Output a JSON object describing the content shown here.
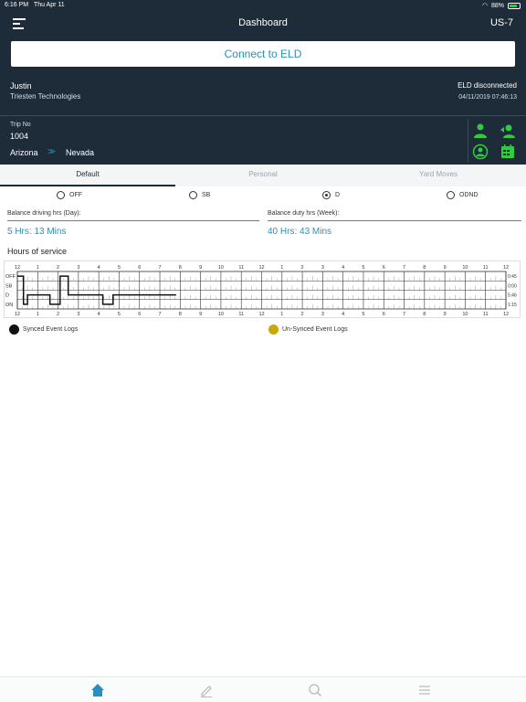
{
  "status_bar": {
    "time": "6:16 PM",
    "date": "Thu Apr 11",
    "battery": "88%"
  },
  "nav": {
    "title": "Dashboard",
    "vehicle": "US-7"
  },
  "connect_label": "Connect to ELD",
  "driver": {
    "name": "Justin",
    "company": "Triesten Technologies"
  },
  "eld": {
    "status": "ELD disconnected",
    "timestamp": "04/11/2019 07:46:13"
  },
  "trip": {
    "label": "Trip No",
    "number": "1004",
    "from": "Arizona",
    "arrows": ">>",
    "to": "Nevada"
  },
  "actions": [
    {
      "icon": "driver-icon"
    },
    {
      "icon": "driver-swap-icon"
    },
    {
      "icon": "driver-sync-icon"
    },
    {
      "icon": "calendar-icon"
    }
  ],
  "tabs": [
    "Default",
    "Personal",
    "Yard Moves"
  ],
  "duty_status": {
    "options": [
      "OFF",
      "SB",
      "D",
      "ODND"
    ],
    "selected": "D"
  },
  "balance": {
    "driving": {
      "label": "Balance driving hrs (Day):",
      "value": "5 Hrs: 13 Mins"
    },
    "duty": {
      "label": "Balance duty hrs (Week):",
      "value": "40 Hrs: 43 Mins"
    }
  },
  "hos": {
    "title": "Hours of service",
    "hour_labels": [
      "12",
      "1",
      "2",
      "3",
      "4",
      "5",
      "6",
      "7",
      "8",
      "9",
      "10",
      "11",
      "12",
      "1",
      "2",
      "3",
      "4",
      "5",
      "6",
      "7",
      "8",
      "9",
      "10",
      "11",
      "12"
    ],
    "rows": [
      "OFF",
      "SB",
      "D",
      "ON"
    ],
    "totals": [
      "0:45",
      "0:00",
      "5:46",
      "1:15"
    ]
  },
  "legend": {
    "synced": {
      "label": "Synced Event Logs",
      "color": "#111111"
    },
    "unsynced": {
      "label": "Un-Synced Event Logs",
      "color": "#c9a80c"
    }
  },
  "tabbar": [
    "home-icon",
    "edit-icon",
    "search-icon",
    "list-icon"
  ],
  "colors": {
    "accent": "#2a8fbd",
    "header": "#1e2b39",
    "action_green": "#2ecc40"
  }
}
